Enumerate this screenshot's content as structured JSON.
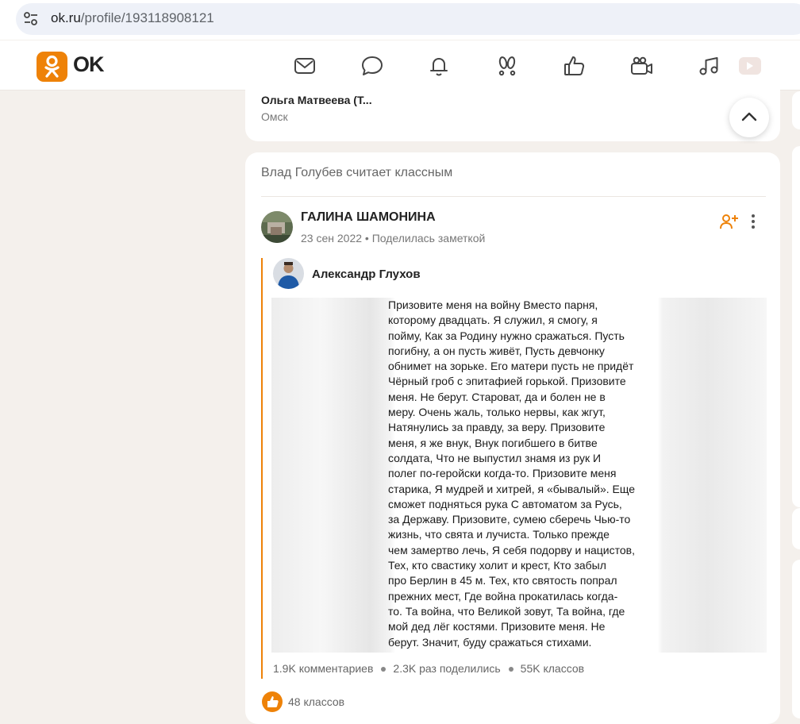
{
  "browser": {
    "url_host": "ok.ru",
    "url_path": "/profile/193118908121",
    "tune_icon": "tune-icon"
  },
  "header": {
    "logo_text": "OK",
    "brand_color": "#ee8208",
    "nav_icons": [
      "mail-icon",
      "chat-icon",
      "bell-icon",
      "guests-icon",
      "like-icon",
      "video-camera-icon",
      "music-icon",
      "video-play-icon"
    ]
  },
  "previous_card": {
    "name": "Ольга Матвеева (Т...",
    "city": "Омск"
  },
  "feed_item": {
    "liked_by": "Влад Голубев считает классным",
    "author": "ГАЛИНА ШАМОНИНА",
    "date": "23 сен 2022",
    "action": "Поделилась заметкой",
    "quoted_author": "Александр Глухов",
    "poem_text": "Призовите меня на войну Вместо парня, которому двадцать. Я служил, я смогу, я пойму, Как за Родину нужно сражаться. Пусть погибну, а он пусть живёт, Пусть девчонку обнимет на зорьке. Его матери пусть не придёт Чёрный гроб с эпитафией горькой. Призовите меня. Не берут. Староват, да и болен не в меру. Очень жаль, только нервы, как жгут, Натянулись за правду, за веру. Призовите меня, я же внук, Внук погибшего в битве солдата, Что не выпустил знамя из рук И полег по-геройски когда-то. Призовите меня старика, Я мудрей и хитрей, я «бывалый». Еще сможет подняться рука С автоматом за Русь, за Державу. Призовите, сумею сберечь Чью-то жизнь, что свята и лучиста. Только прежде чем замертво лечь, Я себя подорву и нацистов, Тех, кто свастику холит и крест, Кто забыл про Берлин в 45 м. Тех, кто святость попрал прежних мест, Где война прокатилась когда-то. Та война, что Великой зовут, Та война, где мой дед лёг костями. Призовите меня. Не берут. Значит, буду сражаться стихами.",
    "poem_lines": [
      "Призовите меня на войну Вместо парня,",
      "которому двадцать. Я служил, я смогу, я",
      "пойму, Как за Родину нужно сражаться. Пусть",
      "погибну, а он пусть живёт, Пусть девчонку",
      "обнимет на зорьке. Его матери пусть не придёт",
      "Чёрный гроб с эпитафией горькой. Призовите",
      "меня. Не берут. Староват, да и болен не в",
      "меру. Очень жаль, только нервы, как жгут,",
      "Натянулись за правду, за веру. Призовите",
      "меня, я же внук, Внук погибшего в битве",
      "солдата, Что не выпустил знамя из рук И",
      "полег по-геройски когда-то. Призовите меня",
      "старика, Я мудрей и хитрей, я «бывалый». Еще",
      "сможет подняться рука С автоматом за Русь,",
      "за Державу. Призовите, сумею сберечь Чью-то",
      "жизнь, что свята и лучиста. Только прежде",
      "чем замертво лечь, Я себя подорву и нацистов,",
      "Тех, кто свастику холит и крест, Кто забыл",
      "про Берлин в 45 м. Тех, кто святость попрал",
      "прежних мест, Где война прокатилась когда-",
      "то. Та война, что Великой зовут, Та война, где",
      "мой дед лёг костями. Призовите меня. Не",
      "берут. Значит, буду сражаться стихами."
    ],
    "stats": {
      "comments": "1.9K комментариев",
      "shares": "2.3K раз поделились",
      "likes": "55K классов"
    },
    "own_likes": "48 классов"
  }
}
